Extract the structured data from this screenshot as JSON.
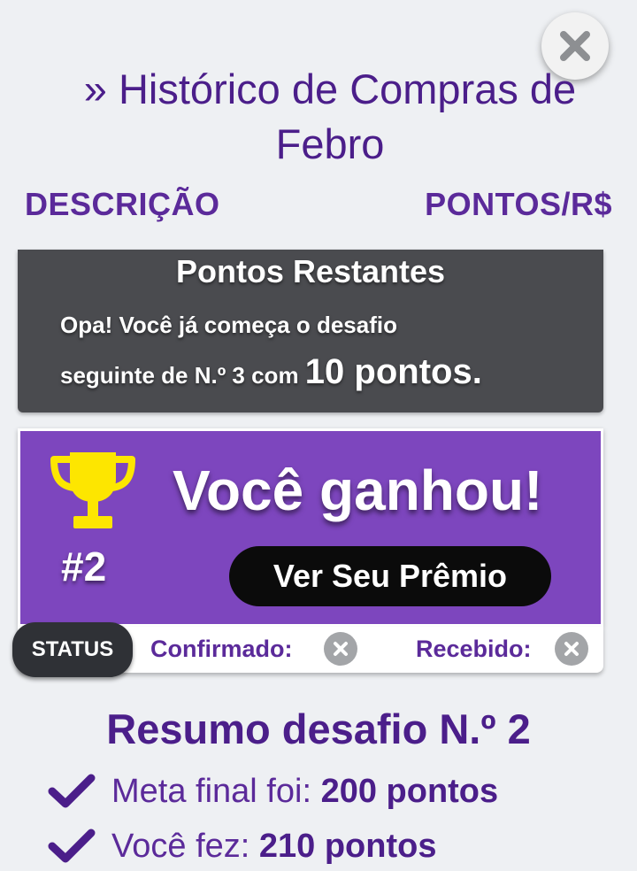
{
  "title": "» Histórico de Compras de Febro",
  "columns": {
    "description": "DESCRIÇÃO",
    "points": "PONTOS/R$"
  },
  "remaining": {
    "title": "Pontos Restantes",
    "line1": "Opa! Você já começa o desafio",
    "line2_prefix": "seguinte de N.º 3 com ",
    "line2_points": "10 pontos."
  },
  "win": {
    "rank": "#2",
    "message": "Você ganhou!",
    "prize_button": "Ver Seu Prêmio"
  },
  "status": {
    "pill": "STATUS",
    "confirmed_label": "Confirmado:",
    "received_label": "Recebido:"
  },
  "summary": {
    "title": "Resumo desafio N.º 2",
    "goal_label": "Meta final foi: ",
    "goal_value": "200 pontos",
    "made_label": "Você fez: ",
    "made_value": "210 pontos"
  },
  "colors": {
    "primary": "#4b1e8a",
    "card_purple": "#7d46be",
    "dark_panel": "#4a4b4f",
    "trophy": "#fde600"
  },
  "icons": [
    "close-icon",
    "trophy-icon",
    "x-circle-icon",
    "check-icon"
  ]
}
